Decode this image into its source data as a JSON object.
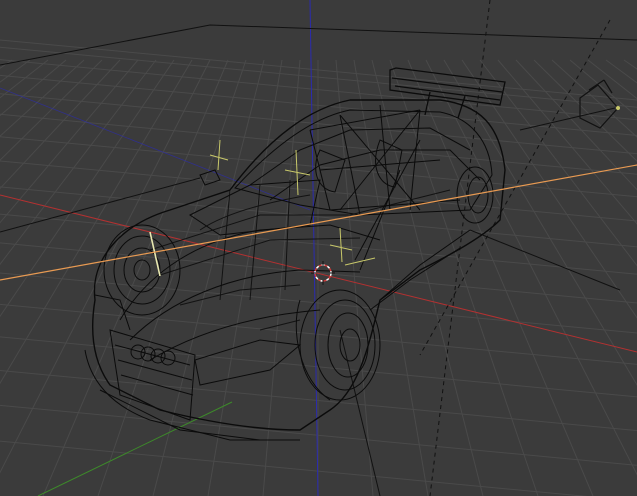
{
  "viewport": {
    "view_mode": "wireframe",
    "background_color": "#3b3b3b",
    "grid_color": "#4a4a4a",
    "wire_color": "#0d0d0d",
    "axis_colors": {
      "x": "#b33131",
      "y": "#3d8a2a",
      "z": "#2b2bb0"
    },
    "selection_line_color": "#e89a52",
    "empty_color": "#c8c86a",
    "cursor_color": "#ffffff"
  },
  "objects": [
    {
      "name": "car-body",
      "icon": "mesh-icon"
    },
    {
      "name": "camera",
      "icon": "camera-icon"
    },
    {
      "name": "empty-handles",
      "icon": "empty-icon"
    },
    {
      "name": "3d-cursor",
      "icon": "cursor-icon"
    }
  ]
}
